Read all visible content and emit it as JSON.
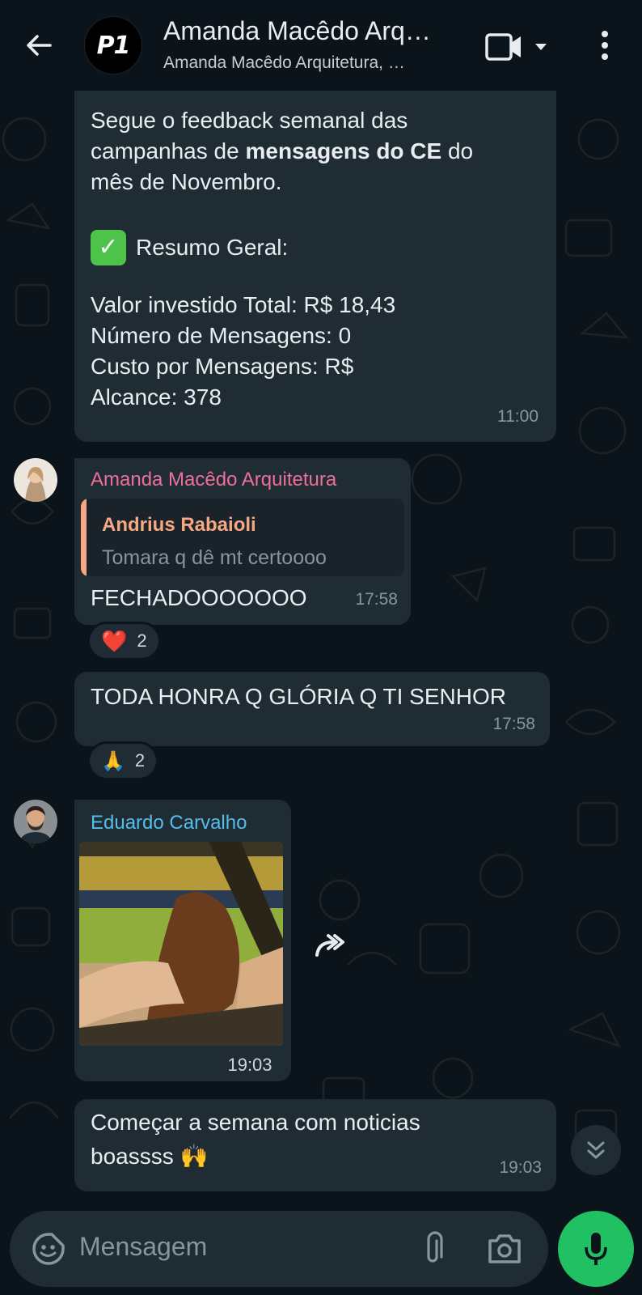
{
  "header": {
    "title": "Amanda Macêdo Arq…",
    "subtitle": "Amanda Macêdo Arquitetura, …",
    "avatar_text": "P1"
  },
  "messages": {
    "m1": {
      "line1": "Segue o feedback semanal das",
      "line2_pre": "campanhas de ",
      "line2_bold": "mensagens do CE",
      "line2_post": " do",
      "line3": "mês de Novembro.",
      "summary_emoji": "✅",
      "summary_label": "Resumo Geral:",
      "stat1": "Valor investido Total: R$ 18,43",
      "stat2": "Número de Mensagens: 0",
      "stat3": "Custo por Mensagens: R$",
      "stat4": "Alcance: 378",
      "time": "11:00"
    },
    "m2": {
      "sender": "Amanda Macêdo Arquitetura",
      "quote_author": "Andrius Rabaioli",
      "quote_text": "Tomara q dê mt certoooo",
      "text": "FECHADOOOOOOO",
      "time": "17:58",
      "reaction_emoji": "❤️",
      "reaction_count": "2"
    },
    "m3": {
      "text": "TODA HONRA Q GLÓRIA Q TI SENHOR",
      "time": "17:58",
      "reaction_emoji": "🙏",
      "reaction_count": "2"
    },
    "m4": {
      "sender": "Eduardo Carvalho",
      "time": "19:03"
    },
    "m5": {
      "line1": "Começar a semana com noticias",
      "line2": "boassss 🙌",
      "time": "19:03"
    }
  },
  "input": {
    "placeholder": "Mensagem"
  },
  "colors": {
    "background": "#0b141a",
    "bubble": "#1f2c34",
    "amanda_name": "#ef6f9a",
    "eduardo_name": "#53bdeb",
    "quote_author": "#f5a883",
    "mic_button": "#21c063"
  }
}
